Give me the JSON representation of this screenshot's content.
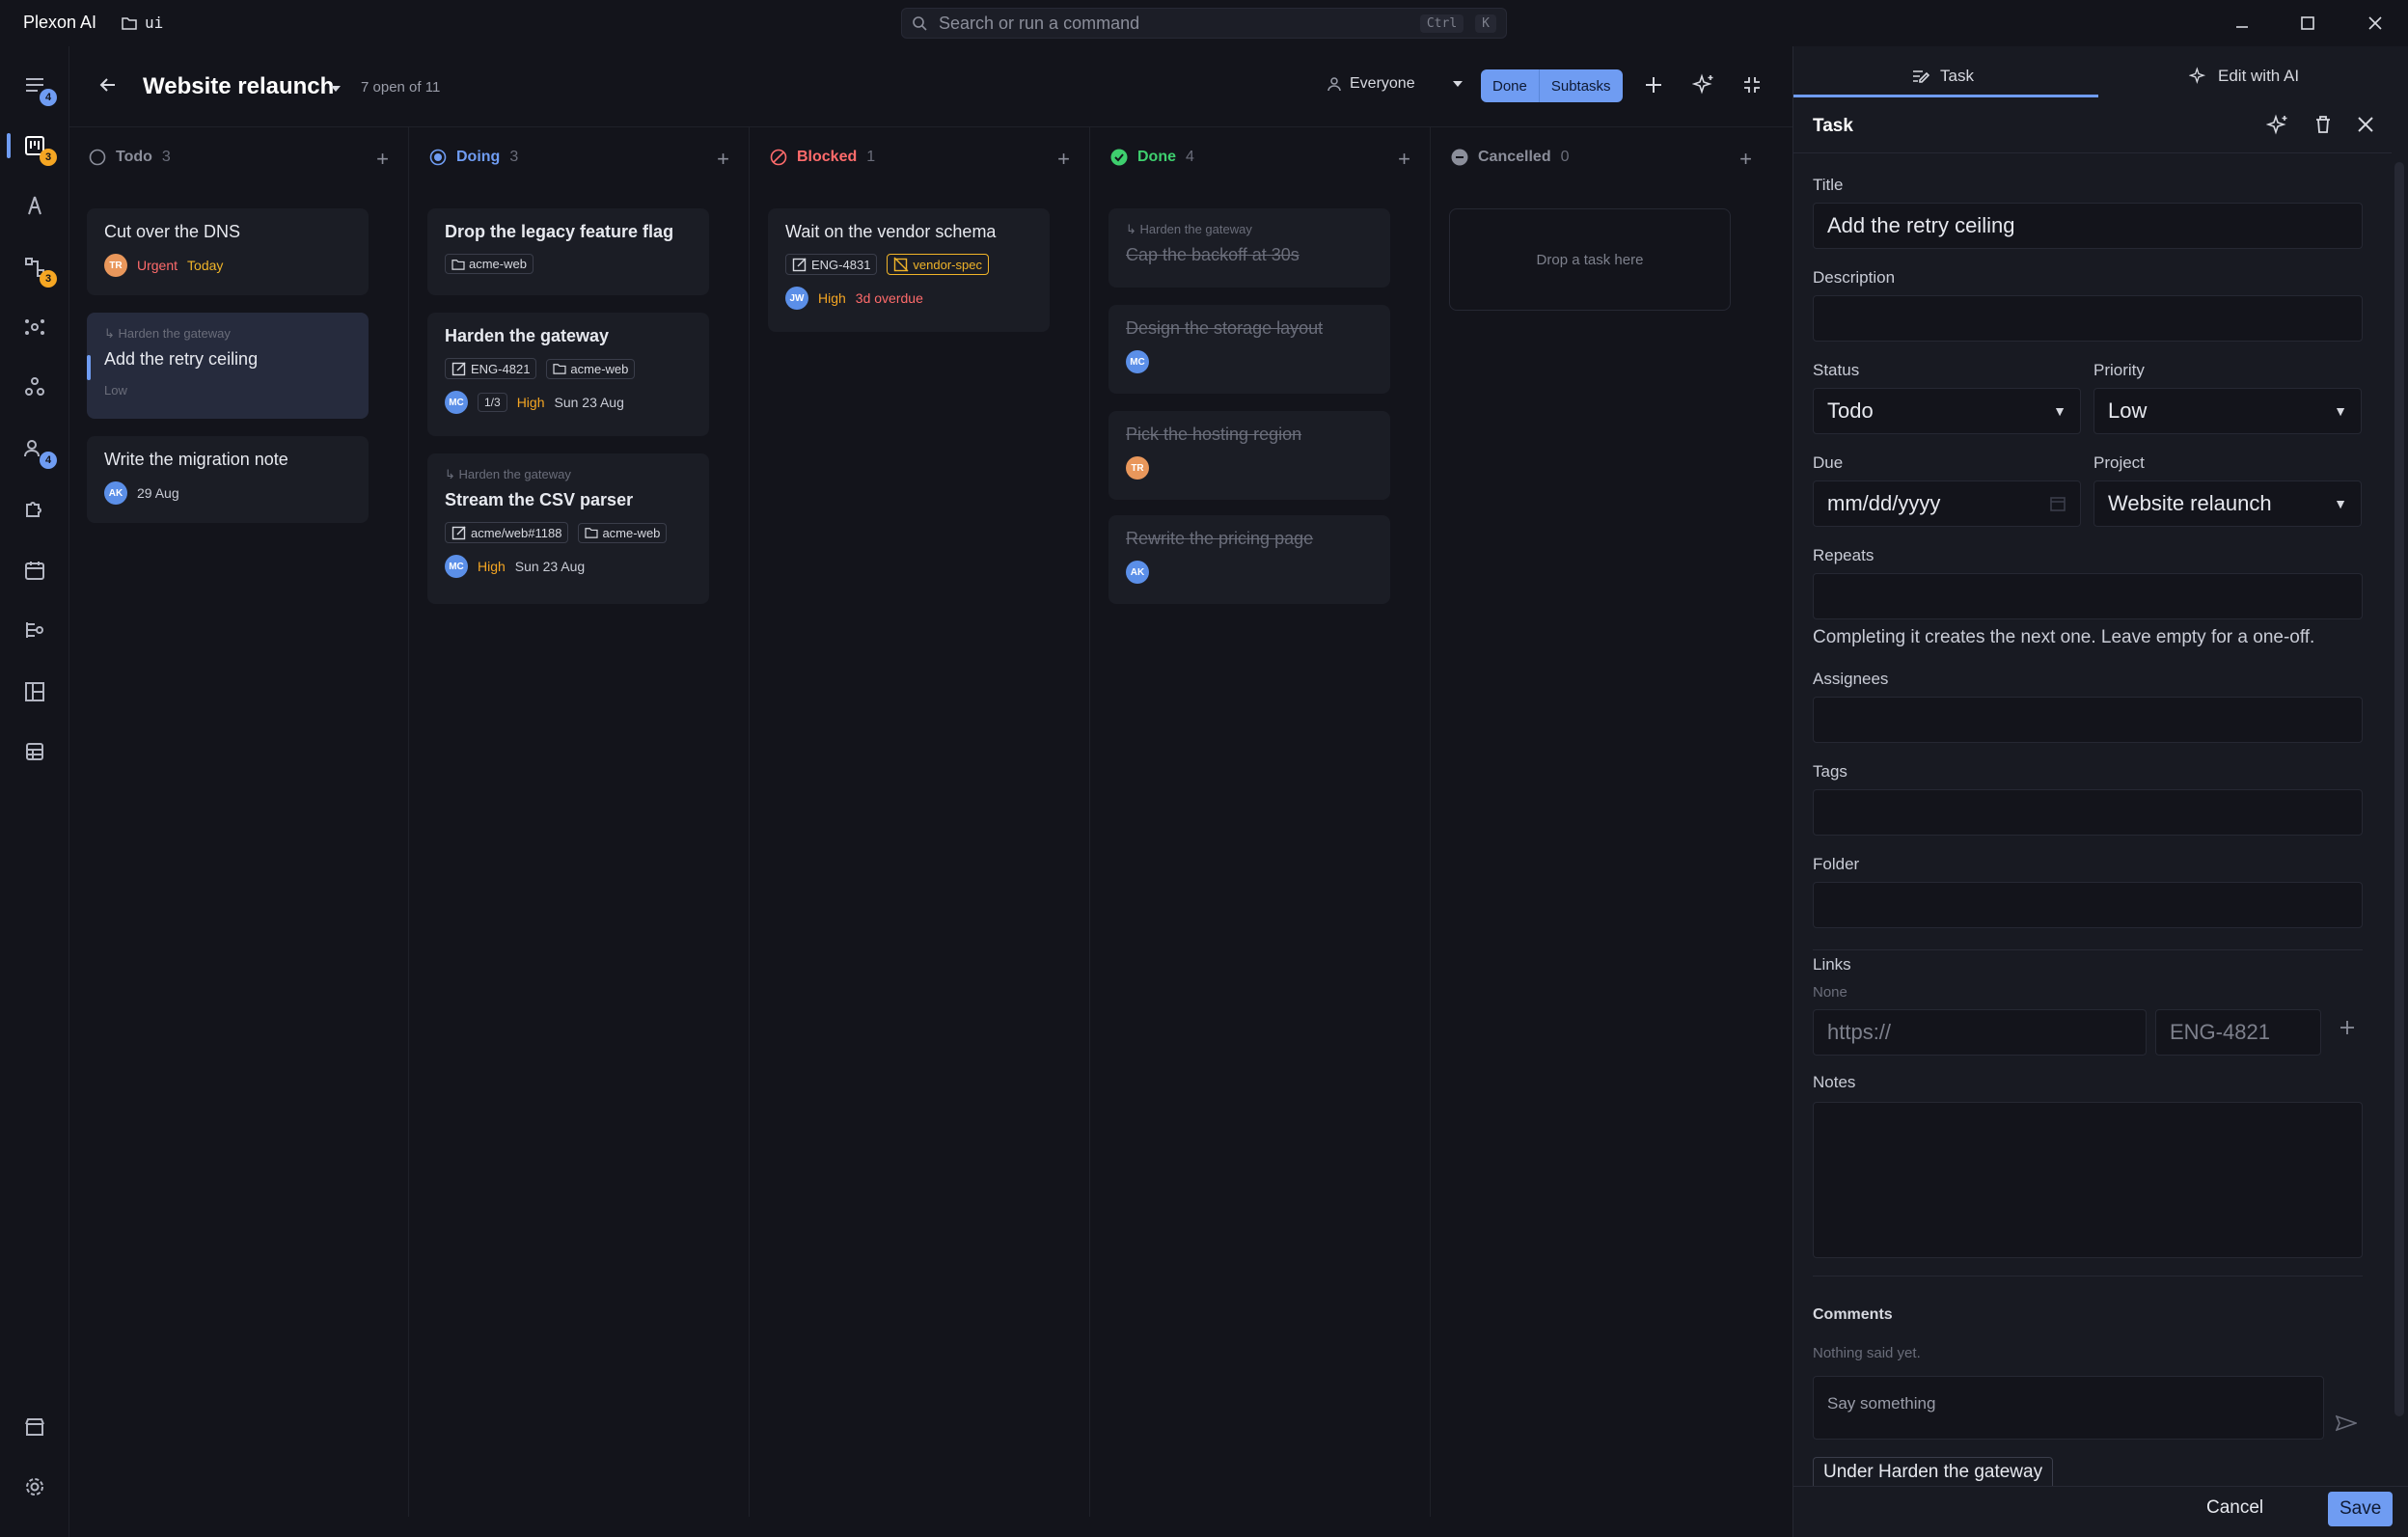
{
  "app": {
    "title": "Plexon AI",
    "folder": "ui"
  },
  "command": {
    "placeholder": "Search or run a command",
    "kbd1": "Ctrl",
    "kbd2": "K"
  },
  "rail": {
    "badges": {
      "inbox": "4",
      "board": "3",
      "graph": "3",
      "team": "4"
    }
  },
  "board": {
    "title": "Website relaunch",
    "open_count": "7 open of 11",
    "filter": "Everyone",
    "seg_done": "Done",
    "seg_subtasks": "Subtasks",
    "columns": [
      {
        "name": "Todo",
        "count": "3"
      },
      {
        "name": "Doing",
        "count": "3"
      },
      {
        "name": "Blocked",
        "count": "1"
      },
      {
        "name": "Done",
        "count": "4"
      },
      {
        "name": "Cancelled",
        "count": "0"
      }
    ],
    "todo": [
      {
        "title": "Cut over the DNS",
        "avatar": "TR",
        "priority": "Urgent",
        "due": "Today"
      },
      {
        "parent": "↳ Harden the gateway",
        "title": "Add the retry ceiling",
        "priority": "Low"
      },
      {
        "title": "Write the migration note",
        "avatar": "AK",
        "due": "29 Aug"
      }
    ],
    "doing": [
      {
        "title": "Drop the legacy feature flag",
        "folder": "acme-web"
      },
      {
        "title": "Harden the gateway",
        "link": "ENG-4821",
        "folder": "acme-web",
        "avatar": "MC",
        "subtasks": "1/3",
        "priority": "High",
        "due": "Sun 23 Aug"
      },
      {
        "parent": "↳ Harden the gateway",
        "title": "Stream the CSV parser",
        "link": "acme/web#1188",
        "folder": "acme-web",
        "avatar": "MC",
        "priority": "High",
        "due": "Sun 23 Aug"
      }
    ],
    "blocked": [
      {
        "title": "Wait on the vendor schema",
        "link": "ENG-4831",
        "broken_link": "vendor-spec",
        "avatar": "JW",
        "priority": "High",
        "due": "3d overdue"
      }
    ],
    "done": [
      {
        "parent": "↳ Harden the gateway",
        "title": "Cap the backoff at 30s"
      },
      {
        "title": "Design the storage layout",
        "avatar": "MC"
      },
      {
        "title": "Pick the hosting region",
        "avatar": "TR"
      },
      {
        "title": "Rewrite the pricing page",
        "avatar": "AK"
      }
    ],
    "cancelled_drop": "Drop a task here"
  },
  "panel": {
    "tab_task": "Task",
    "tab_ai": "Edit with AI",
    "header": "Task",
    "title_label": "Title",
    "title_value": "Add the retry ceiling",
    "description_label": "Description",
    "status_label": "Status",
    "status_value": "Todo",
    "priority_label": "Priority",
    "priority_value": "Low",
    "due_label": "Due",
    "due_placeholder": "mm/dd/yyyy",
    "project_label": "Project",
    "project_value": "Website relaunch",
    "repeats_label": "Repeats",
    "repeats_help": "Completing it creates the next one. Leave empty for a one-off.",
    "assignees_label": "Assignees",
    "tags_label": "Tags",
    "folder_label": "Folder",
    "links_label": "Links",
    "links_none": "None",
    "link_url_placeholder": "https://",
    "link_id_placeholder": "ENG-4821",
    "notes_label": "Notes",
    "comments_label": "Comments",
    "comments_empty": "Nothing said yet.",
    "comment_placeholder": "Say something",
    "parent_chip": "Under Harden the gateway",
    "cancel": "Cancel",
    "save": "Save"
  },
  "colors": {
    "accent": "#6f9cf2",
    "urgent": "#ff6b6b",
    "high": "#f5a623",
    "done": "#3ecf6e",
    "blocked": "#ff6b6b"
  }
}
